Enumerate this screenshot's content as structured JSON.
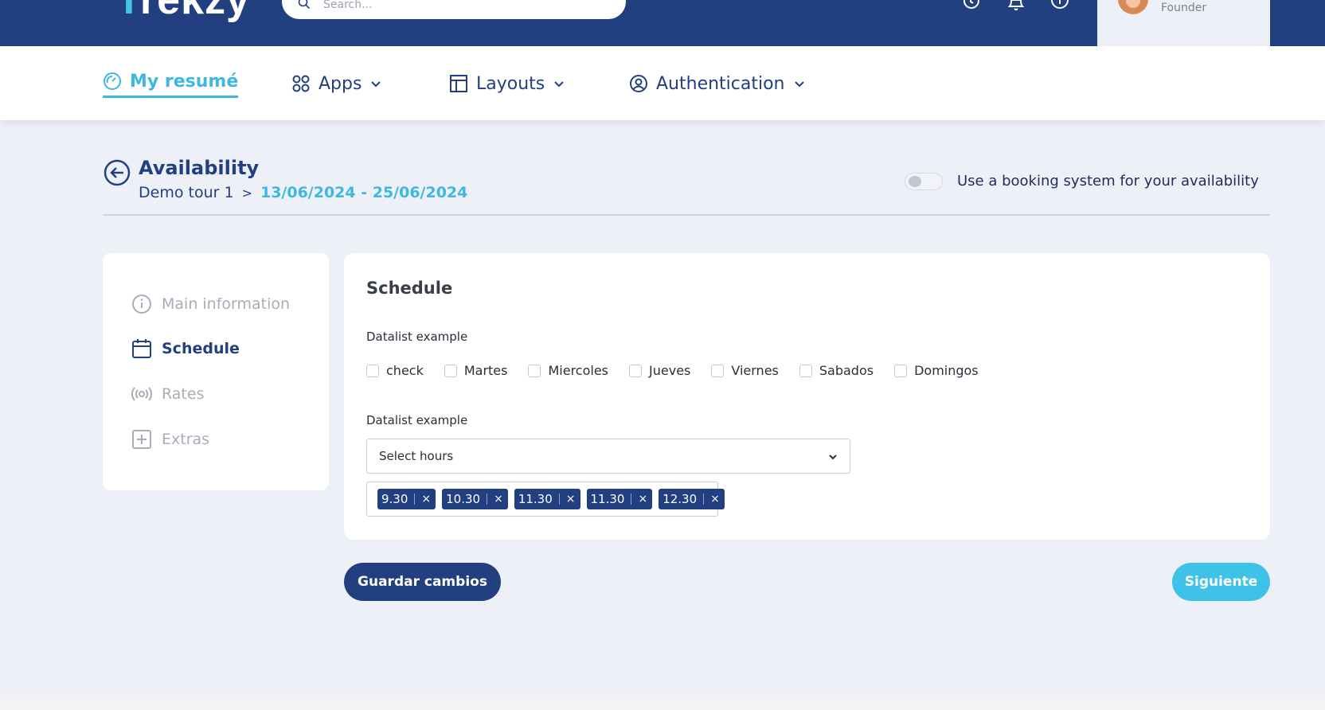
{
  "app": {
    "logo_main": "rekzy",
    "logo_accent": "T"
  },
  "topbar": {
    "search_placeholder": "Search...",
    "icons": [
      "history-icon",
      "bell-icon",
      "info-icon"
    ],
    "user_role": "Founder"
  },
  "nav": {
    "items": [
      {
        "label": "My resumé",
        "icon": "dashboard-icon",
        "active": true
      },
      {
        "label": "Apps",
        "icon": "apps-grid-icon"
      },
      {
        "label": "Layouts",
        "icon": "layout-icon"
      },
      {
        "label": "Authentication",
        "icon": "user-circle-icon"
      }
    ]
  },
  "header": {
    "title": "Availability",
    "tour": "Demo tour 1",
    "separator": ">",
    "date_range": "13/06/2024 - 25/06/2024",
    "booking_toggle_label": "Use a booking system for your availability",
    "booking_toggle_on": false
  },
  "steps": [
    {
      "label": "Main information",
      "icon": "info-circle-icon",
      "active": false
    },
    {
      "label": "Schedule",
      "icon": "calendar-icon",
      "active": true
    },
    {
      "label": "Rates",
      "icon": "broadcast-icon",
      "active": false
    },
    {
      "label": "Extras",
      "icon": "plus-square-icon",
      "active": false
    }
  ],
  "schedule": {
    "title": "Schedule",
    "days_label": "Datalist example",
    "days": [
      "check",
      "Martes",
      "Miercoles",
      "Jueves",
      "Viernes",
      "Sabados",
      "Domingos"
    ],
    "hours_label": "Datalist example",
    "hours_select": "Select hours",
    "selected_hours": [
      "9.30",
      "10.30",
      "11.30",
      "11.30",
      "12.30"
    ],
    "tag_remove": "×"
  },
  "actions": {
    "save": "Guardar cambios",
    "next": "Siguiente"
  },
  "colors": {
    "primary": "#223f80",
    "accent": "#3fc2e8",
    "background": "#eef0f8"
  }
}
